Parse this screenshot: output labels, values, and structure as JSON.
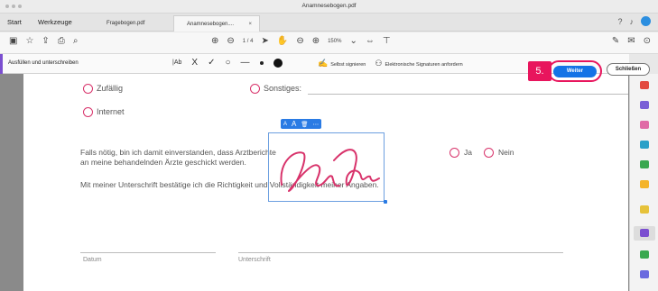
{
  "window": {
    "title": "Anamnesebogen.pdf"
  },
  "menu": {
    "start": "Start",
    "tools": "Werkzeuge"
  },
  "tabs": [
    {
      "label": "Fragebogen.pdf"
    },
    {
      "label": "Anamnesebogen....",
      "close": "×"
    }
  ],
  "toolbar": {
    "page_indicator": "1  / 4",
    "zoom": "150%"
  },
  "signbar": {
    "title": "Ausfüllen und unterschreiben",
    "text_tool": "|Ab",
    "self_sign": "Selbst signieren",
    "request_sign": "Elektronische Signaturen anfordern",
    "step": "5.",
    "weiter": "Weiter",
    "schliessen": "Schließen"
  },
  "form": {
    "option_random": "Zufällig",
    "option_other": "Sonstiges:",
    "option_internet": "Internet",
    "consent_line1": "Falls nötig, bin ich damit einverstanden, dass Arztberichte",
    "consent_line2": "an meine behandelnden Ärzte geschickt werden.",
    "yes": "Ja",
    "no": "Nein",
    "confirm": "Mit meiner Unterschrift bestätige ich die Richtigkeit und Vollständigkeit meiner Angaben.",
    "date_label": "Datum",
    "signature_label": "Unterschrift"
  },
  "colors": {
    "accent": "#e8155d",
    "primary": "#1473e6",
    "signature": "#d8336b"
  }
}
